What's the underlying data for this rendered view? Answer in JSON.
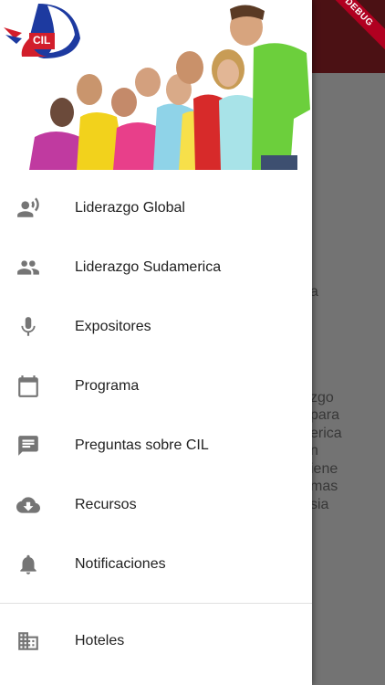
{
  "background": {
    "fragments": [
      "a",
      "zgo",
      "para",
      "erica",
      "n",
      "iene",
      "mas",
      "sia"
    ]
  },
  "debug_banner": "DEBUG",
  "header": {
    "logo_text": "CIL"
  },
  "menu": {
    "items": [
      {
        "label": "Liderazgo Global",
        "icon": "speaker-person-icon"
      },
      {
        "label": "Liderazgo Sudamerica",
        "icon": "people-icon"
      },
      {
        "label": "Expositores",
        "icon": "microphone-icon"
      },
      {
        "label": "Programa",
        "icon": "calendar-icon"
      },
      {
        "label": "Preguntas sobre CIL",
        "icon": "message-icon"
      },
      {
        "label": "Recursos",
        "icon": "cloud-download-icon"
      },
      {
        "label": "Notificaciones",
        "icon": "bell-icon"
      }
    ],
    "secondary": [
      {
        "label": "Hoteles",
        "icon": "building-icon"
      }
    ]
  },
  "colors": {
    "app_bar": "#a4262c",
    "icon": "#757575",
    "debug": "#b00020"
  }
}
